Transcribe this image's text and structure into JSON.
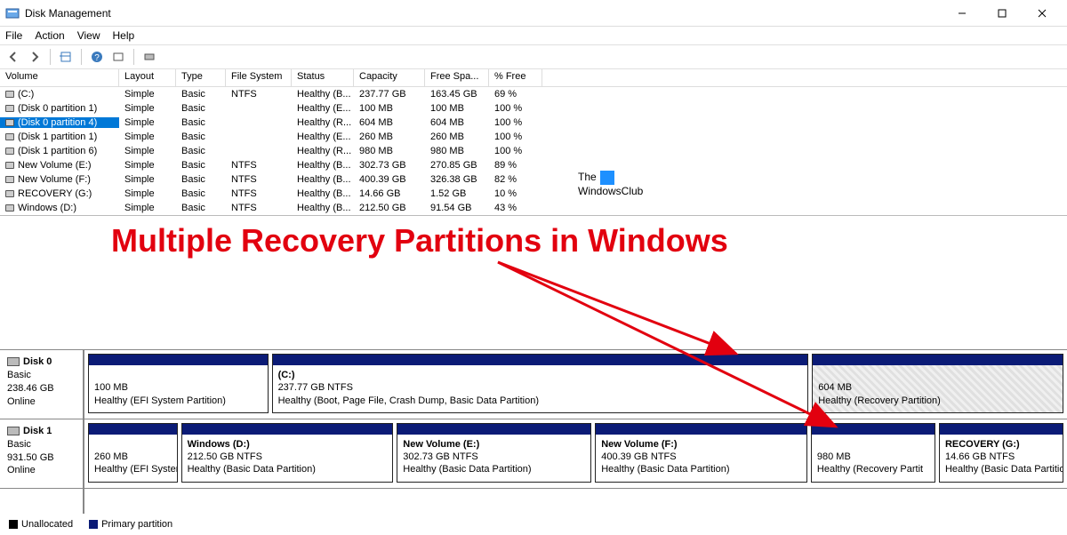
{
  "window": {
    "title": "Disk Management"
  },
  "menubar": [
    "File",
    "Action",
    "View",
    "Help"
  ],
  "columns": [
    "Volume",
    "Layout",
    "Type",
    "File System",
    "Status",
    "Capacity",
    "Free Spa...",
    "% Free"
  ],
  "volumes": [
    {
      "name": "(C:)",
      "layout": "Simple",
      "type": "Basic",
      "fs": "NTFS",
      "status": "Healthy (B...",
      "cap": "237.77 GB",
      "free": "163.45 GB",
      "pct": "69 %",
      "selected": false
    },
    {
      "name": "(Disk 0 partition 1)",
      "layout": "Simple",
      "type": "Basic",
      "fs": "",
      "status": "Healthy (E...",
      "cap": "100 MB",
      "free": "100 MB",
      "pct": "100 %",
      "selected": false
    },
    {
      "name": "(Disk 0 partition 4)",
      "layout": "Simple",
      "type": "Basic",
      "fs": "",
      "status": "Healthy (R...",
      "cap": "604 MB",
      "free": "604 MB",
      "pct": "100 %",
      "selected": true
    },
    {
      "name": "(Disk 1 partition 1)",
      "layout": "Simple",
      "type": "Basic",
      "fs": "",
      "status": "Healthy (E...",
      "cap": "260 MB",
      "free": "260 MB",
      "pct": "100 %",
      "selected": false
    },
    {
      "name": "(Disk 1 partition 6)",
      "layout": "Simple",
      "type": "Basic",
      "fs": "",
      "status": "Healthy (R...",
      "cap": "980 MB",
      "free": "980 MB",
      "pct": "100 %",
      "selected": false
    },
    {
      "name": "New Volume (E:)",
      "layout": "Simple",
      "type": "Basic",
      "fs": "NTFS",
      "status": "Healthy (B...",
      "cap": "302.73 GB",
      "free": "270.85 GB",
      "pct": "89 %",
      "selected": false
    },
    {
      "name": "New Volume (F:)",
      "layout": "Simple",
      "type": "Basic",
      "fs": "NTFS",
      "status": "Healthy (B...",
      "cap": "400.39 GB",
      "free": "326.38 GB",
      "pct": "82 %",
      "selected": false
    },
    {
      "name": "RECOVERY (G:)",
      "layout": "Simple",
      "type": "Basic",
      "fs": "NTFS",
      "status": "Healthy (B...",
      "cap": "14.66 GB",
      "free": "1.52 GB",
      "pct": "10 %",
      "selected": false
    },
    {
      "name": "Windows (D:)",
      "layout": "Simple",
      "type": "Basic",
      "fs": "NTFS",
      "status": "Healthy (B...",
      "cap": "212.50 GB",
      "free": "91.54 GB",
      "pct": "43 %",
      "selected": false
    }
  ],
  "watermark": {
    "line1": "The",
    "line2": "WindowsClub"
  },
  "annotation": "Multiple Recovery Partitions in Windows",
  "disks": [
    {
      "name": "Disk 0",
      "type": "Basic",
      "size": "238.46 GB",
      "status": "Online",
      "parts": [
        {
          "title": "",
          "line2": "100 MB",
          "line3": "Healthy (EFI System Partition)",
          "flex": 20,
          "hatched": false
        },
        {
          "title": "(C:)",
          "line2": "237.77 GB NTFS",
          "line3": "Healthy (Boot, Page File, Crash Dump, Basic Data Partition)",
          "flex": 60,
          "hatched": false
        },
        {
          "title": "",
          "line2": "604 MB",
          "line3": "Healthy (Recovery Partition)",
          "flex": 28,
          "hatched": true
        }
      ]
    },
    {
      "name": "Disk 1",
      "type": "Basic",
      "size": "931.50 GB",
      "status": "Online",
      "parts": [
        {
          "title": "",
          "line2": "260 MB",
          "line3": "Healthy (EFI System",
          "flex": 10,
          "hatched": false
        },
        {
          "title": "Windows  (D:)",
          "line2": "212.50 GB NTFS",
          "line3": "Healthy (Basic Data Partition)",
          "flex": 24,
          "hatched": false
        },
        {
          "title": "New Volume  (E:)",
          "line2": "302.73 GB NTFS",
          "line3": "Healthy (Basic Data Partition)",
          "flex": 22,
          "hatched": false
        },
        {
          "title": "New Volume  (F:)",
          "line2": "400.39 GB NTFS",
          "line3": "Healthy (Basic Data Partition)",
          "flex": 24,
          "hatched": false
        },
        {
          "title": "",
          "line2": "980 MB",
          "line3": "Healthy (Recovery Partit",
          "flex": 14,
          "hatched": false
        },
        {
          "title": "RECOVERY  (G:)",
          "line2": "14.66 GB NTFS",
          "line3": "Healthy (Basic Data Partition)",
          "flex": 14,
          "hatched": false
        }
      ]
    }
  ],
  "legend": {
    "unalloc": "Unallocated",
    "primary": "Primary partition"
  }
}
